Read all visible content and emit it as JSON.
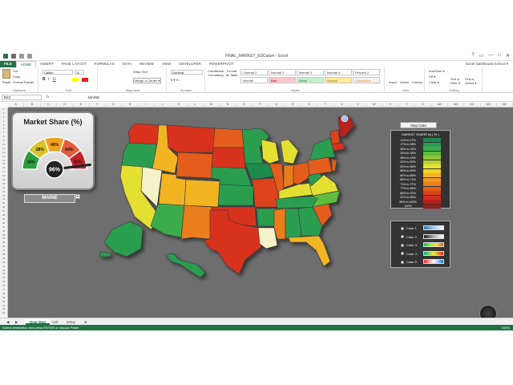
{
  "window": {
    "title": "FINAL_MARKET_ESCalum - Excel",
    "user": "Excel Dashboard School ▾",
    "controls": [
      "?",
      "▭",
      "—",
      "□",
      "✕"
    ]
  },
  "tabs": [
    "FILE",
    "HOME",
    "INSERT",
    "PAGE LAYOUT",
    "FORMULAS",
    "DATA",
    "REVIEW",
    "VIEW",
    "DEVELOPER",
    "POWERPIVOT"
  ],
  "ribbon": {
    "clipboard": {
      "paste": "Paste",
      "cut": "Cut",
      "copy": "Copy",
      "format_painter": "Format Painter",
      "label": "Clipboard"
    },
    "font": {
      "name": "Calibri",
      "size": "11",
      "label": "Font"
    },
    "alignment": {
      "wrap": "Wrap Text",
      "merge": "Merge & Center ▾",
      "label": "Alignment"
    },
    "number": {
      "format": "General",
      "label": "Number"
    },
    "styles": {
      "conditional": "Conditional Formatting",
      "format_table": "Format as Table",
      "items": [
        {
          "label": "Comma 2",
          "bg": "#ffffff",
          "fg": "#333333"
        },
        {
          "label": "Normal 2",
          "bg": "#ffffff",
          "fg": "#333333"
        },
        {
          "label": "Normal 3",
          "bg": "#ffffff",
          "fg": "#333333"
        },
        {
          "label": "Normal 4",
          "bg": "#ffffff",
          "fg": "#333333"
        },
        {
          "label": "Percent 2",
          "bg": "#ffffff",
          "fg": "#333333"
        },
        {
          "label": "Normal",
          "bg": "#ffffff",
          "fg": "#333333"
        },
        {
          "label": "Bad",
          "bg": "#ffc7ce",
          "fg": "#9c0006"
        },
        {
          "label": "Good",
          "bg": "#c6efce",
          "fg": "#006100"
        },
        {
          "label": "Neutral",
          "bg": "#ffeb9c",
          "fg": "#9c6500"
        },
        {
          "label": "Calculation",
          "bg": "#f2f2f2",
          "fg": "#fa7d00"
        }
      ],
      "label": "Styles"
    },
    "cells": {
      "insert": "Insert",
      "delete": "Delete",
      "format": "Format",
      "label": "Cells"
    },
    "editing": {
      "autosum": "AutoSum ▾",
      "fill": "Fill ▾",
      "clear": "Clear ▾",
      "sort": "Sort & Filter ▾",
      "find": "Find & Select ▾",
      "label": "Editing"
    }
  },
  "formula_bar": {
    "cell": "B23",
    "fx": "fx",
    "value": "MAINE"
  },
  "columns": [
    "A",
    "B",
    "C",
    "D",
    "E",
    "F",
    "G",
    "H",
    "I",
    "J",
    "K",
    "L",
    "M",
    "N",
    "O",
    "P",
    "Q",
    "R",
    "S",
    "T",
    "U",
    "V",
    "W",
    "X",
    "Y",
    "Z",
    "AA",
    "AB",
    "AC",
    "AD",
    "AE"
  ],
  "rows_start": 1,
  "rows_count": 53,
  "gauge": {
    "title": "Market Share (%)",
    "value_label": "96%",
    "value": 0.96,
    "ticks": [
      "16%",
      "28%",
      "46%",
      "64%",
      "82%"
    ],
    "band_colors": [
      "#2a9d3a",
      "#d9c326",
      "#f0a020",
      "#e45c3a",
      "#c2252a"
    ]
  },
  "selected_state": "MAINE",
  "legend": {
    "title": "Map Data",
    "header": "MARKET SHARE by ( % )",
    "rows": [
      {
        "label": "12% to 17%",
        "color": "#1e8b4c"
      },
      {
        "label": "17% to 28%",
        "color": "#2a9d50"
      },
      {
        "label": "28% to 33%",
        "color": "#3aac4a"
      },
      {
        "label": "33% to 38%",
        "color": "#5fbb3e"
      },
      {
        "label": "38% to 43%",
        "color": "#8cc63a"
      },
      {
        "label": "43% to 53%",
        "color": "#b8d433"
      },
      {
        "label": "53% to 58%",
        "color": "#e3e031"
      },
      {
        "label": "58% to 60%",
        "color": "#f5d22a"
      },
      {
        "label": "60% to 66%",
        "color": "#f3b421"
      },
      {
        "label": "66% to 71%",
        "color": "#ee9a1c"
      },
      {
        "label": "71% to 77%",
        "color": "#ea7d1b"
      },
      {
        "label": "77% to 86%",
        "color": "#e45d1b"
      },
      {
        "label": "86% to 91%",
        "color": "#dc421b"
      },
      {
        "label": "91% to 96%",
        "color": "#d02d1d"
      },
      {
        "label": "96% to 100%",
        "color": "#b8201f"
      },
      {
        "label": "100%",
        "color": "#9c1a1a"
      }
    ]
  },
  "color_options": [
    {
      "label": "Color 1",
      "gradient": "linear-gradient(90deg,#3a6ea5,#9ccbf0,#ffffff)",
      "selected": false
    },
    {
      "label": "Color 2",
      "gradient": "linear-gradient(90deg,#222,#aaa,#fff)",
      "selected": false
    },
    {
      "label": "Color 3",
      "gradient": "linear-gradient(90deg,#0b7,#9e3,#fd3,#e53)",
      "selected": true
    },
    {
      "label": "Color 4",
      "gradient": "linear-gradient(90deg,#1a8,#ee3,#e22)",
      "selected": false
    },
    {
      "label": "Color 5",
      "gradient": "linear-gradient(90deg,#e22,#fff,#27d)",
      "selected": false
    }
  ],
  "sheet_tabs": [
    "Heat Map",
    "calc",
    "setup"
  ],
  "status": {
    "text": "Select destination and press ENTER or choose Paste",
    "zoom": "100%"
  }
}
